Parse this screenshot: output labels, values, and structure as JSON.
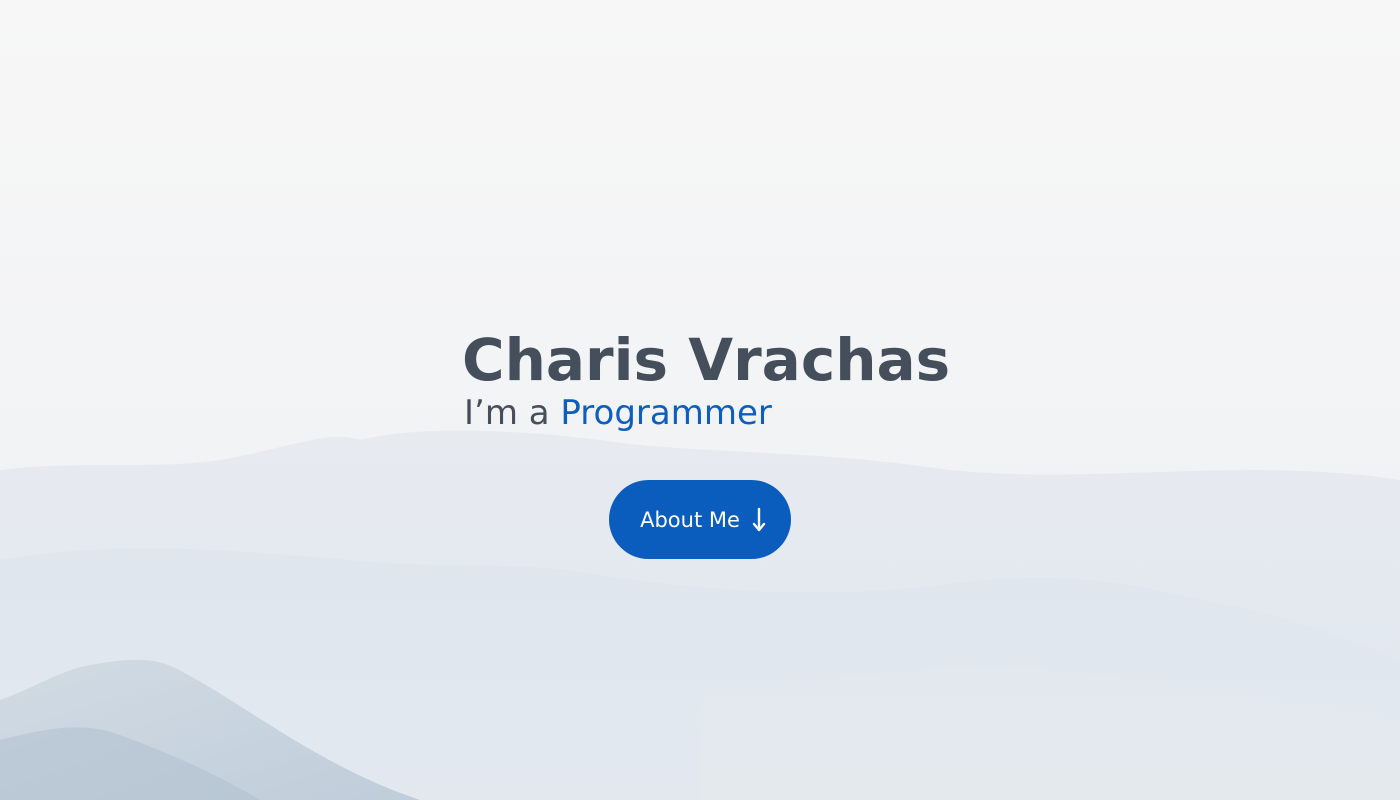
{
  "hero": {
    "name": "Charis Vrachas",
    "subtitle_prefix": "I’m a ",
    "subtitle_role": "Programmer",
    "button_label": "About Me",
    "button_icon": "arrow-down-icon"
  },
  "colors": {
    "accent": "#0a5dbd",
    "heading": "#454f5c",
    "background": "#f5f6f8"
  }
}
